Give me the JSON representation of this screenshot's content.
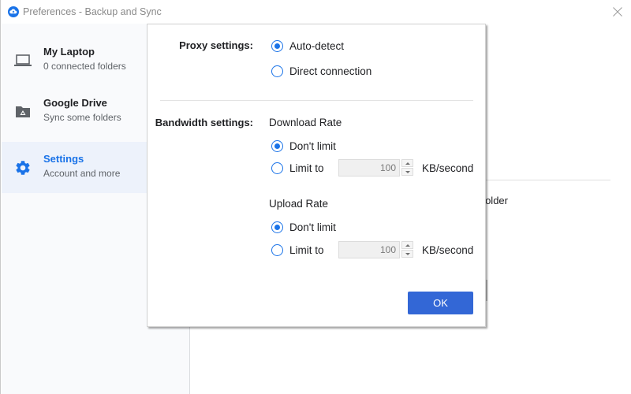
{
  "window": {
    "title": "Preferences - Backup and Sync",
    "app_icon": "cloud-upload-icon",
    "close_icon": "close-icon"
  },
  "sidebar": {
    "items": [
      {
        "title": "My Laptop",
        "subtitle": "0 connected folders",
        "icon": "laptop-icon",
        "active": false
      },
      {
        "title": "Google Drive",
        "subtitle": "Sync some folders",
        "icon": "drive-folder-icon",
        "active": false
      },
      {
        "title": "Settings",
        "subtitle": "Account and more",
        "icon": "gear-icon",
        "active": true
      }
    ]
  },
  "background": {
    "partial_text": "older"
  },
  "dialog": {
    "proxy": {
      "label": "Proxy settings:",
      "options": [
        {
          "label": "Auto-detect",
          "checked": true
        },
        {
          "label": "Direct connection",
          "checked": false
        }
      ]
    },
    "bandwidth": {
      "label": "Bandwidth settings:",
      "download": {
        "heading": "Download Rate",
        "options": [
          {
            "label": "Don't limit",
            "checked": true
          },
          {
            "label": "Limit to",
            "checked": false
          }
        ],
        "value": "100",
        "unit": "KB/second"
      },
      "upload": {
        "heading": "Upload Rate",
        "options": [
          {
            "label": "Don't limit",
            "checked": true
          },
          {
            "label": "Limit to",
            "checked": false
          }
        ],
        "value": "100",
        "unit": "KB/second"
      }
    },
    "ok_label": "OK"
  },
  "colors": {
    "accent": "#1a73e8",
    "ok_button": "#3367d6",
    "sidebar_bg": "#f9fafc",
    "active_item_bg": "#edf2fb"
  }
}
